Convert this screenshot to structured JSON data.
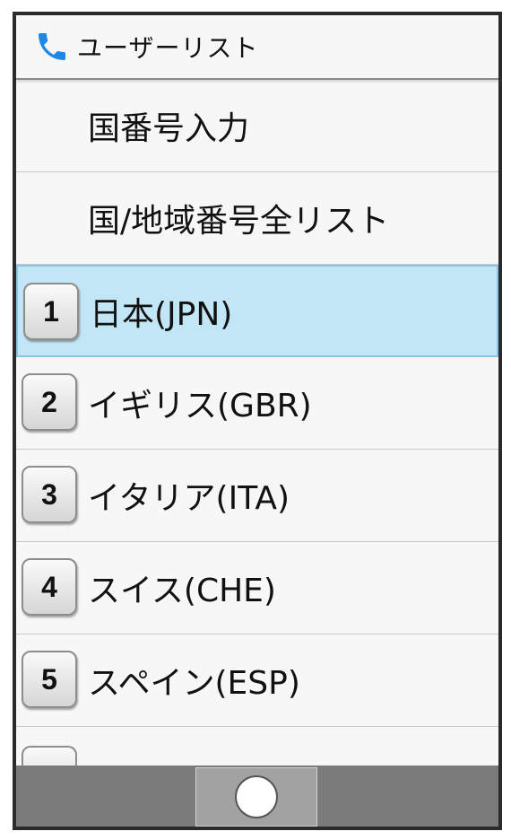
{
  "header": {
    "icon": "phone-icon",
    "title": "ユーザーリスト",
    "icon_color": "#1e88e5"
  },
  "menu": [
    {
      "label": "国番号入力"
    },
    {
      "label": "国/地域番号全リスト"
    }
  ],
  "countries": [
    {
      "key": "1",
      "label": "日本(JPN)",
      "selected": true
    },
    {
      "key": "2",
      "label": "イギリス(GBR)"
    },
    {
      "key": "3",
      "label": "イタリア(ITA)"
    },
    {
      "key": "4",
      "label": "スイス(CHE)"
    },
    {
      "key": "5",
      "label": "スペイン(ESP)"
    }
  ],
  "nav": {
    "home_icon": "home-circle-icon"
  },
  "colors": {
    "selected_bg": "#c3e6f7",
    "bottom_bar": "#7b7b7b"
  }
}
